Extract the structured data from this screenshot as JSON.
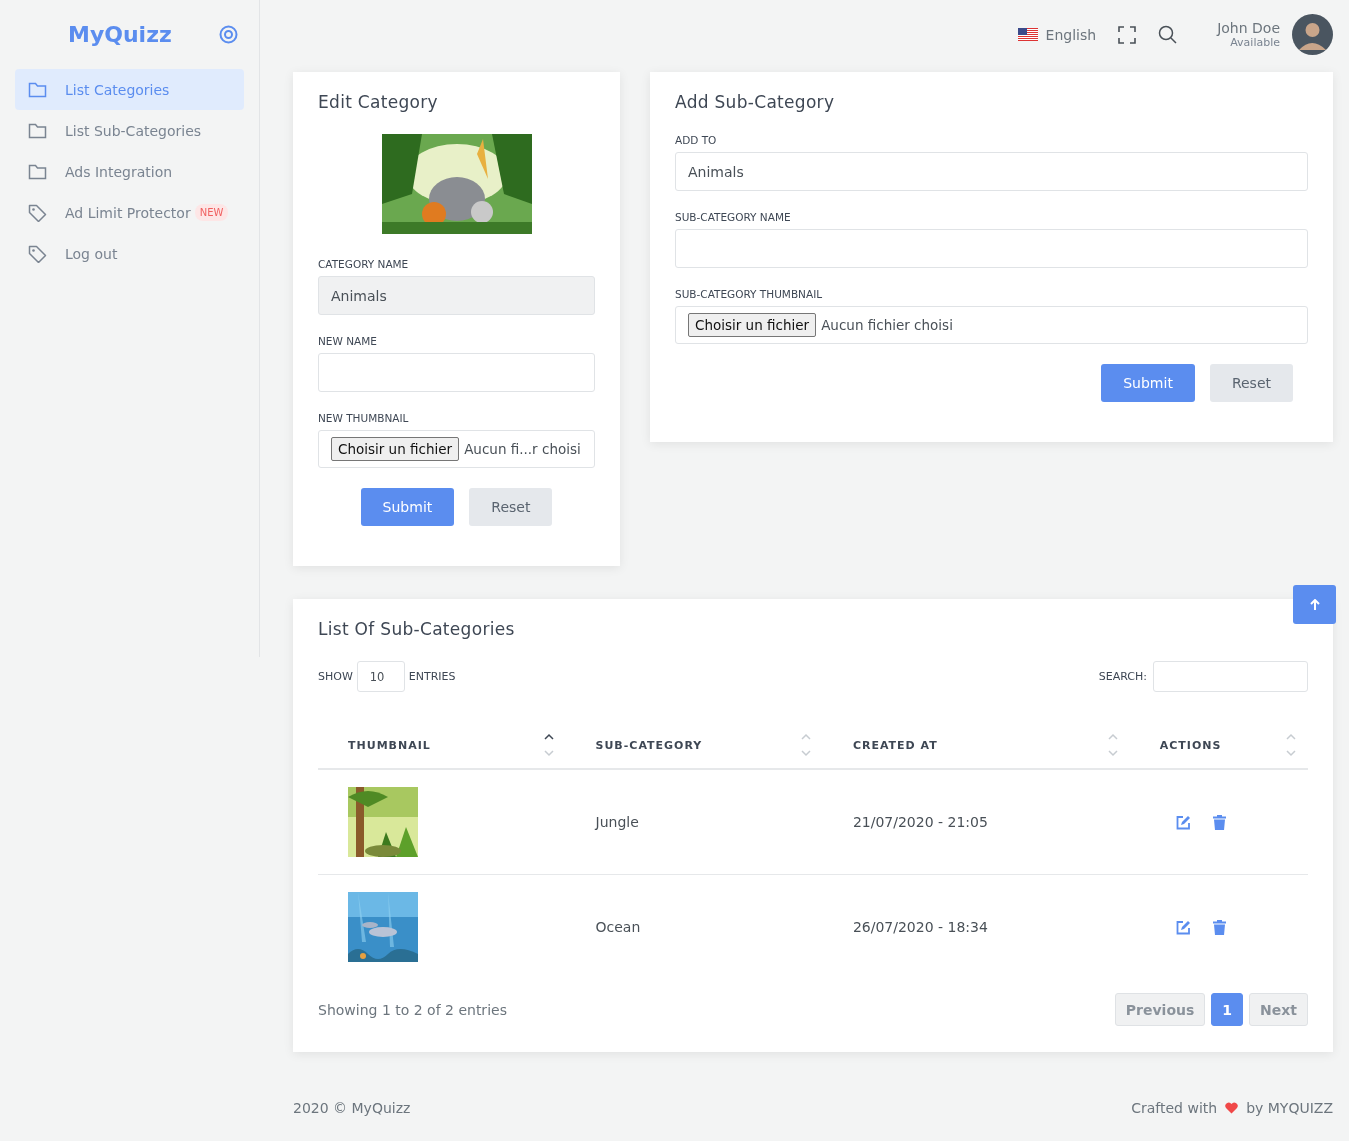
{
  "sidebar": {
    "logo": "MyQuizz",
    "items": [
      {
        "label": "List Categories",
        "kind": "folder",
        "selected": true
      },
      {
        "label": "List Sub-Categories",
        "kind": "folder",
        "selected": false
      },
      {
        "label": "Ads Integration",
        "kind": "folder",
        "selected": false
      },
      {
        "label": "Ad Limit Protector",
        "kind": "tag",
        "selected": false,
        "badge": "NEW"
      },
      {
        "label": "Log out",
        "kind": "tag",
        "selected": false
      }
    ]
  },
  "header": {
    "language": "English",
    "user": {
      "name": "John Doe",
      "status": "Available"
    }
  },
  "edit_category": {
    "title": "Edit Category",
    "fields": [
      {
        "label": "CATEGORY NAME",
        "kind": "readonly",
        "value": "Animals"
      },
      {
        "label": "NEW NAME",
        "kind": "text"
      },
      {
        "label": "NEW THUMBNAIL",
        "kind": "file",
        "button": "Choisir un fichier",
        "value": "Aucun fi...r choisi"
      }
    ],
    "buttons": [
      {
        "label": "Submit",
        "kind": "primary"
      },
      {
        "label": "Reset",
        "kind": "secondary"
      }
    ]
  },
  "add_sub_category": {
    "title": "Add Sub-Category",
    "fields": [
      {
        "label": "ADD TO",
        "kind": "text",
        "value": "Animals"
      },
      {
        "label": "SUB-CATEGORY NAME",
        "kind": "text"
      },
      {
        "label": "SUB-CATEGORY THUMBNAIL",
        "kind": "file",
        "button": "Choisir un fichier",
        "value": "Aucun fichier choisi"
      }
    ],
    "buttons": [
      {
        "label": "Submit",
        "kind": "primary"
      },
      {
        "label": "Reset",
        "kind": "secondary"
      }
    ]
  },
  "table": {
    "title": "List Of Sub-Categories",
    "show_label": "SHOW",
    "page_size": "10",
    "entries_label": "ENTRIES",
    "search_label": "SEARCH:",
    "columns": [
      {
        "label": "THUMBNAIL",
        "selected": true
      },
      {
        "label": "SUB-CATEGORY",
        "selected": false
      },
      {
        "label": "CREATED AT",
        "selected": false
      },
      {
        "label": "ACTIONS",
        "selected": false
      }
    ],
    "rows": [
      {
        "name": "Jungle",
        "created_at": "21/07/2020 - 21:05"
      },
      {
        "name": "Ocean",
        "created_at": "26/07/2020 - 18:34"
      }
    ],
    "info": "Showing 1 to 2 of 2 entries",
    "pagination": [
      {
        "label": "Previous",
        "selected": false
      },
      {
        "label": "1",
        "selected": true
      },
      {
        "label": "Next",
        "selected": false
      }
    ]
  },
  "footer": {
    "left": "2020 © MyQuizz",
    "crafted": "Crafted with",
    "by": "by MYQUIZZ"
  }
}
